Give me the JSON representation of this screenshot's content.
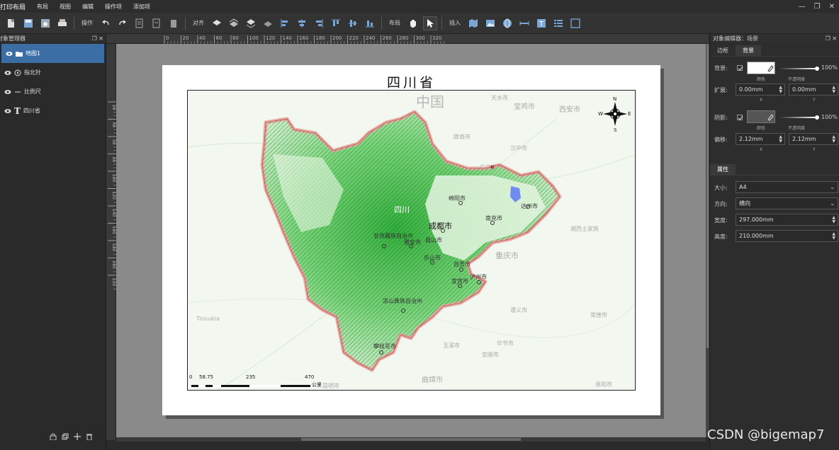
{
  "menubar": {
    "app_title": "打印布局",
    "items": [
      "布局",
      "视图",
      "编辑",
      "操作项",
      "添加项"
    ]
  },
  "toolbar": {
    "op_label": "操作",
    "align_label": "对齐",
    "layout_label": "布局",
    "insert_label": "插入"
  },
  "layer_panel": {
    "title": "对象管理器",
    "layers": [
      {
        "label": "地图1",
        "icon": "folder-icon",
        "selected": true
      },
      {
        "label": "指北针",
        "icon": "compass-icon",
        "selected": false
      },
      {
        "label": "比例尺",
        "icon": "scale-icon",
        "selected": false
      },
      {
        "label": "四川省",
        "icon": "text-icon",
        "selected": false
      }
    ]
  },
  "ruler_top": [
    "0",
    "20",
    "40",
    "60",
    "80",
    "100",
    "120",
    "140",
    "160",
    "180",
    "200",
    "220",
    "240",
    "260",
    "280",
    "300",
    "320"
  ],
  "ruler_left": [
    "20",
    "40",
    "60",
    "80",
    "100",
    "120",
    "140",
    "160",
    "180",
    "200",
    "220"
  ],
  "map": {
    "title": "四川省",
    "region_label": "中国",
    "cities": {
      "chengdu": "成都市",
      "mianyang": "绵阳市",
      "nanchong": "南充市",
      "dazhou": "达州市",
      "ganzi": "甘孜藏族自治州",
      "yaan": "雅安市",
      "meishan": "眉山市",
      "leshan": "乐山市",
      "zigong": "自贡市",
      "yibin": "宜宾市",
      "luzhou": "泸州市",
      "liangshan": "凉山彝族自治州",
      "panzhihua": "攀枝花市",
      "guangyuan": "广元市",
      "sichuan": "四川"
    },
    "outside_labels": {
      "baoji": "宝鸡市",
      "xian": "西安市",
      "tianshui": "天水市",
      "longnan": "陇南市",
      "hanzhong": "汉中市",
      "chongqing": "重庆市",
      "zunyi": "遵义市",
      "qujing": "曲靖市",
      "kunming": "昆明市",
      "tinsukia": "Tinsukia",
      "bijie": "毕节市",
      "anshun": "安顺市",
      "changde": "常德市",
      "xiangxi": "湘西土家族",
      "yuxi": "玉溪市",
      "guiyang": "贵阳市"
    },
    "compass": {
      "n": "N",
      "s": "S",
      "e": "E",
      "w": "W"
    },
    "scale": {
      "ticks": [
        "0",
        "58.75",
        "235",
        "470"
      ],
      "unit": "公里"
    }
  },
  "object_editor": {
    "title": "对象编辑器：场景",
    "tabs": [
      "边框",
      "背景"
    ],
    "active_tab": "背景",
    "background": {
      "label": "背景:",
      "color_sub": "颜色",
      "opacity_sub": "不透明度",
      "opacity": "100%"
    },
    "expand": {
      "label": "扩展:",
      "x": "0.00mm",
      "y": "0.00mm",
      "x_sub": "X",
      "y_sub": "Y"
    },
    "shadow": {
      "label": "阴影:",
      "color_sub": "颜色",
      "opacity_sub": "不透明度",
      "opacity": "100%"
    },
    "offset": {
      "label": "偏移:",
      "x": "2.12mm",
      "y": "2.12mm",
      "x_sub": "X",
      "y_sub": "Y"
    },
    "props_tab": "属性",
    "size": {
      "label": "大小:",
      "value": "A4"
    },
    "orientation": {
      "label": "方向:",
      "value": "横向"
    },
    "width": {
      "label": "宽度:",
      "value": "297.000mm"
    },
    "height": {
      "label": "高度:",
      "value": "210.000mm"
    }
  },
  "watermark": "CSDN @bigemap7",
  "colors": {
    "accent": "#3b6ea5",
    "terrain": "#1fae2a",
    "boundary": "#e7a9a2"
  }
}
